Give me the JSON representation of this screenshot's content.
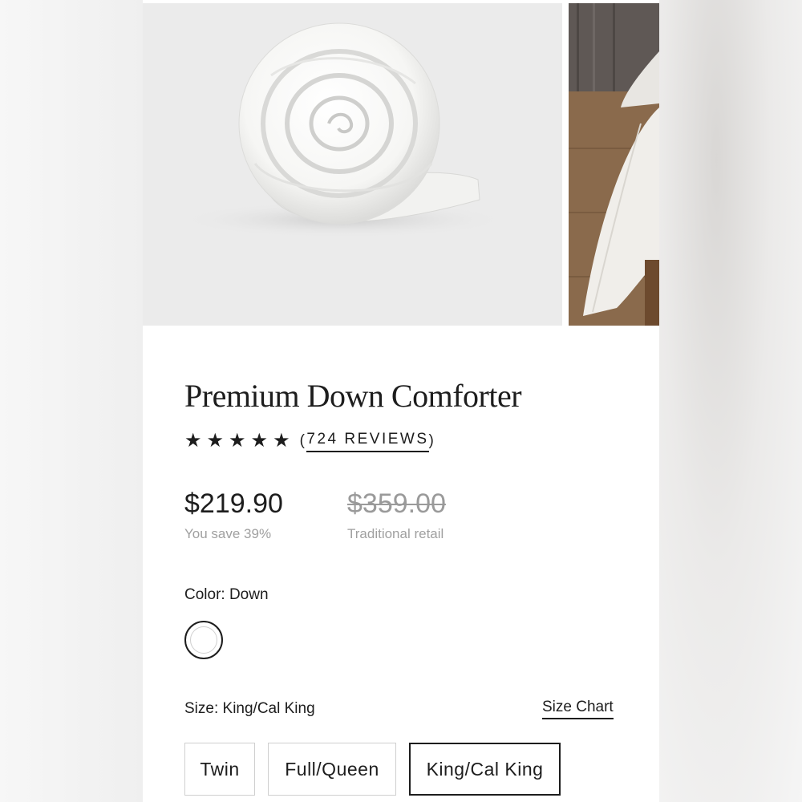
{
  "product": {
    "title": "Premium Down Comforter",
    "rating_stars": 5,
    "reviews": {
      "open_paren": "(",
      "count_text": "724 REVIEWS",
      "close_paren": ")"
    }
  },
  "pricing": {
    "current_price": "$219.90",
    "savings_text": "You save 39%",
    "original_price": "$359.00",
    "original_caption": "Traditional retail"
  },
  "color": {
    "label": "Color: Down",
    "swatch_color": "#ffffff"
  },
  "size": {
    "label": "Size: King/Cal King",
    "size_chart_link": "Size Chart",
    "options": [
      "Twin",
      "Full/Queen",
      "King/Cal King"
    ],
    "selected": "King/Cal King"
  },
  "icons": {
    "star": "star-icon",
    "star_glyph": "★"
  },
  "colors": {
    "text": "#1d1d1d",
    "muted": "#a0a0a0",
    "strikethrough": "#9a9a9a"
  }
}
